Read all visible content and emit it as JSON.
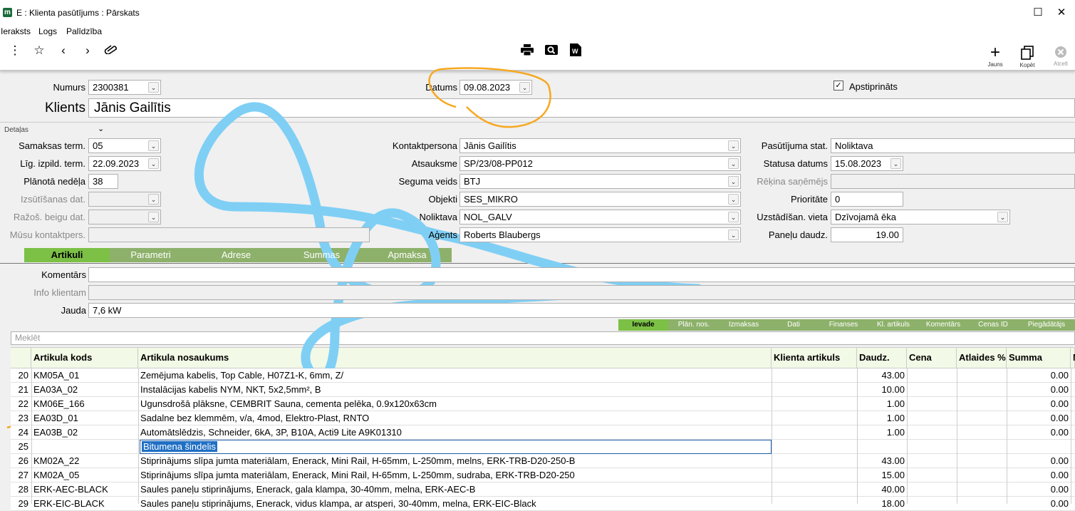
{
  "window": {
    "title": "E : Klienta pasūtījums : Pārskats",
    "icon": "m",
    "maximize": "☐",
    "close": "✕"
  },
  "menu": [
    "Ieraksts",
    "Logs",
    "Palīdzība"
  ],
  "toolbar": {
    "jauns": "Jauns",
    "kopet": "Kopēt",
    "atcelt": "Atcelt"
  },
  "header": {
    "numurs_label": "Numurs",
    "numurs": "2300381",
    "datums_label": "Datums",
    "datums": "09.08.2023",
    "apstiprinats": "Apstiprināts",
    "klients_label": "Klients",
    "klients": "Jānis Gailītis",
    "detalas": "Detaļas"
  },
  "left": [
    {
      "label": "Samaksas term.",
      "value": "05",
      "dd": true,
      "dis": false
    },
    {
      "label": "Līg. izpild. term.",
      "value": "22.09.2023",
      "dd": true,
      "dis": false
    },
    {
      "label": "Plānotā nedēļa",
      "value": "38",
      "dd": false,
      "dis": false
    },
    {
      "label": "Izsūtīšanas dat.",
      "value": "",
      "dd": true,
      "dis": true
    },
    {
      "label": "Ražoš. beigu dat.",
      "value": "",
      "dd": true,
      "dis": true
    },
    {
      "label": "Mūsu kontaktpers.",
      "value": "",
      "dd": false,
      "dis": true
    }
  ],
  "middle": [
    {
      "label": "Kontaktpersona",
      "value": "Jānis Gailītis"
    },
    {
      "label": "Atsauksme",
      "value": "SP/23/08-PP012"
    },
    {
      "label": "Seguma veids",
      "value": "BTJ"
    },
    {
      "label": "Objekti",
      "value": "SES_MIKRO"
    },
    {
      "label": "Noliktava",
      "value": "NOL_GALV"
    },
    {
      "label": "Aģents",
      "value": "Roberts Blaubergs"
    }
  ],
  "right": [
    {
      "label": "Pasūtījuma stat.",
      "value": "Noliktava",
      "dis": false
    },
    {
      "label": "Statusa datums",
      "value": "15.08.2023",
      "dis": false
    },
    {
      "label": "Rēķina saņēmējs",
      "value": "",
      "dis": true
    },
    {
      "label": "Prioritāte",
      "value": "0",
      "dis": false
    },
    {
      "label": "Uzstādīšan. vieta",
      "value": "Dzīvojamā ēka",
      "dis": false
    },
    {
      "label": "Paneļu daudz.",
      "value": "19.00",
      "dis": false
    }
  ],
  "tabs": [
    "Artikuli",
    "Parametri",
    "Adrese",
    "Summas",
    "Apmaksa"
  ],
  "info": [
    {
      "label": "Komentārs",
      "value": "",
      "dis": false
    },
    {
      "label": "Info klientam",
      "value": "",
      "dis": true
    },
    {
      "label": "Jauda",
      "value": "7,6 kW",
      "dis": false
    }
  ],
  "search_placeholder": "Meklēt",
  "subtabs": [
    "Ievade",
    "Plān. nos.",
    "Izmaksas",
    "Dati",
    "Finanses",
    "Kl. artikuls",
    "Komentārs",
    "Cenas ID",
    "Piegādātājs"
  ],
  "columns": [
    "Artikula kods",
    "Artikula nosaukums",
    "Klienta artikuls",
    "Daudz.",
    "Cena",
    "Atlaides %",
    "Summa",
    "N"
  ],
  "rows": [
    {
      "n": "20",
      "code": "KM05A_01",
      "name": "Zemējuma kabelis, Top Cable, H07Z1-K, 6mm, Z/",
      "qty": "43.00",
      "sum": "0.00"
    },
    {
      "n": "21",
      "code": "EA03A_02",
      "name": "Instalācijas kabelis NYM, NKT, 5x2,5mm², B",
      "qty": "10.00",
      "sum": "0.00"
    },
    {
      "n": "22",
      "code": "KM06E_166",
      "name": "Ugunsdrošā plāksne, CEMBRIT Sauna, cementa pelēka, 0.9x120x63cm",
      "qty": "1.00",
      "sum": "0.00"
    },
    {
      "n": "23",
      "code": "EA03D_01",
      "name": "Sadalne bez klemmēm, v/a, 4mod, Elektro-Plast, RNTO",
      "qty": "1.00",
      "sum": "0.00"
    },
    {
      "n": "24",
      "code": "EA03B_02",
      "name": "Automātslēdzis, Schneider, 6kA, 3P, B10A, Acti9 Lite A9K01310",
      "qty": "1.00",
      "sum": "0.00"
    },
    {
      "n": "25",
      "code": "",
      "name": "Bitumena šindelis",
      "qty": "",
      "sum": ""
    },
    {
      "n": "26",
      "code": "KM02A_22",
      "name": "Stiprinājums slīpa jumta materiālam, Enerack, Mini Rail, H-65mm, L-250mm, melns, ERK-TRB-D20-250-B",
      "qty": "43.00",
      "sum": "0.00"
    },
    {
      "n": "27",
      "code": "KM02A_05",
      "name": "Stiprinājums slīpa jumta materiālam, Enerack, Mini Rail, H-65mm, L-250mm, sudraba, ERK-TRB-D20-250",
      "qty": "15.00",
      "sum": "0.00"
    },
    {
      "n": "28",
      "code": "ERK-AEC-BLACK",
      "name": "Saules paneļu stiprinājums, Enerack, gala klampa, 30-40mm, melna, ERK-AEC-B",
      "qty": "40.00",
      "sum": "0.00"
    },
    {
      "n": "29",
      "code": "ERK-EIC-BLACK",
      "name": "Saules paneļu stiprinājums, Enerack, vidus klampa, ar atsperi, 30-40mm, melna, ERK-EIC-Black",
      "qty": "18.00",
      "sum": "0.00"
    }
  ]
}
